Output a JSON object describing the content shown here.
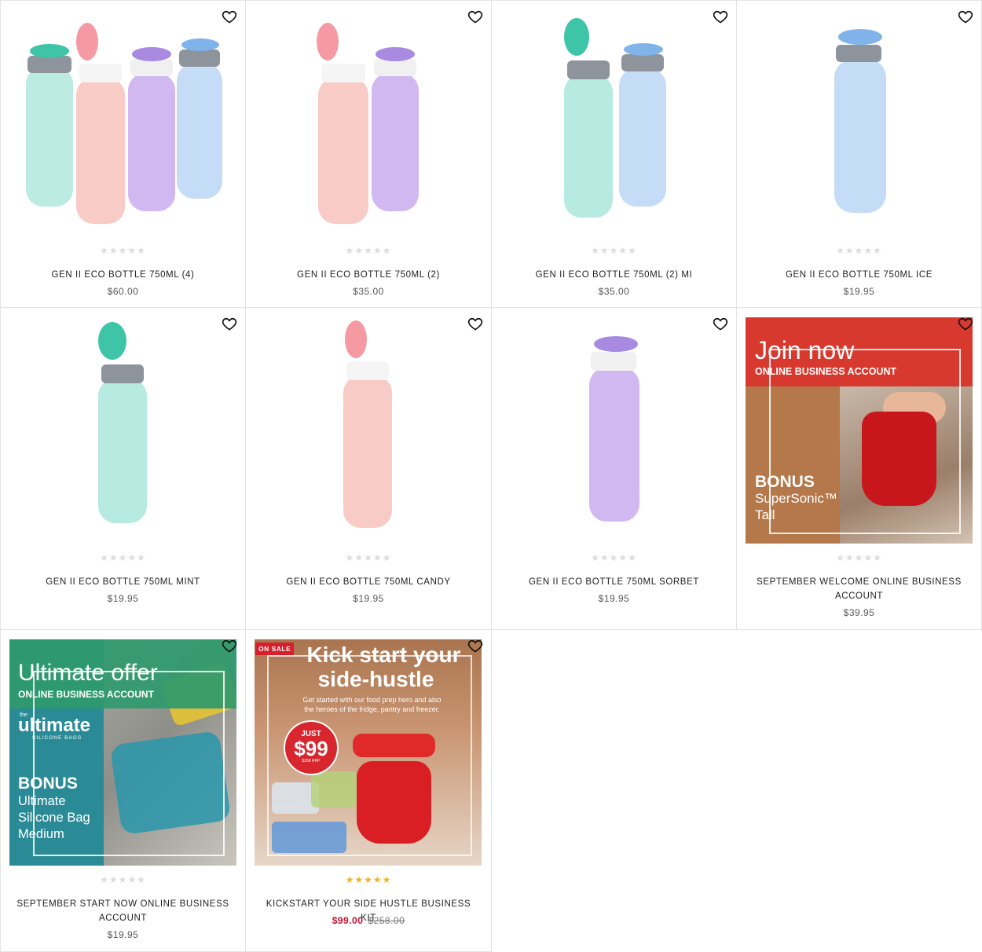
{
  "wishlist_icon": "heart-outline-icon",
  "products": [
    {
      "title": "GEN II ECO BOTTLE 750ML (4)",
      "price": "$60.00",
      "rating_stars": 0
    },
    {
      "title": "GEN II ECO BOTTLE 750ML (2)",
      "price": "$35.00",
      "rating_stars": 0
    },
    {
      "title": "GEN II ECO BOTTLE 750ML (2) MI",
      "price": "$35.00",
      "rating_stars": 0
    },
    {
      "title": "GEN II ECO BOTTLE 750ML ICE",
      "price": "$19.95",
      "rating_stars": 0
    },
    {
      "title": "GEN II ECO BOTTLE 750ML MINT",
      "price": "$19.95",
      "rating_stars": 0
    },
    {
      "title": "GEN II ECO BOTTLE 750ML CANDY",
      "price": "$19.95",
      "rating_stars": 0
    },
    {
      "title": "GEN II ECO BOTTLE 750ML SORBET",
      "price": "$19.95",
      "rating_stars": 0
    },
    {
      "title": "SEPTEMBER WELCOME ONLINE BUSINESS ACCOUNT",
      "price": "$39.95",
      "rating_stars": 0,
      "banner": {
        "headline": "Join now",
        "subhead": "ONLINE BUSINESS ACCOUNT",
        "bonus": "BONUS",
        "bonus_line1": "SuperSonic™",
        "bonus_line2": "Tall"
      }
    },
    {
      "title": "SEPTEMBER START NOW ONLINE BUSINESS ACCOUNT",
      "price": "$19.95",
      "rating_stars": 0,
      "banner": {
        "headline": "Ultimate offer",
        "subhead": "ONLINE BUSINESS ACCOUNT",
        "logo": "ultimate",
        "logo_small": "the",
        "logo_sub": "SILICONE BAGS",
        "bonus": "BONUS",
        "bonus_line1": "Ultimate",
        "bonus_line2": "Silicone Bag",
        "bonus_line3": "Medium"
      }
    },
    {
      "title": "KICKSTART YOUR SIDE HUSTLE BUSINESS KIT",
      "price": "$99.00",
      "original_price": "$258.00",
      "rating_stars": 5,
      "on_sale": true,
      "banner": {
        "badge": "ON SALE",
        "headline1": "Kick start your",
        "headline2": "side-hustle",
        "tagline1": "Get started with our food prep hero and also",
        "tagline2": "the heroes of the fridge, pantry and freezer.",
        "just": "JUST",
        "amount": "$99",
        "rrp": "$258 RRP"
      }
    }
  ],
  "bottle_colors": {
    "mint": "#9fe3d6",
    "candy": "#f7b9b3",
    "sorbet": "#c7a6ec",
    "ice": "#b6d3f5",
    "mint_cap": "#3ec4a6",
    "candy_cap": "#f59aa2",
    "sorbet_cap": "#a88be0",
    "ice_cap": "#7fb3ea"
  },
  "star_colors": {
    "empty": "#dcdcdc",
    "filled": "#f2b51f"
  },
  "sale_color": "#c8102e"
}
